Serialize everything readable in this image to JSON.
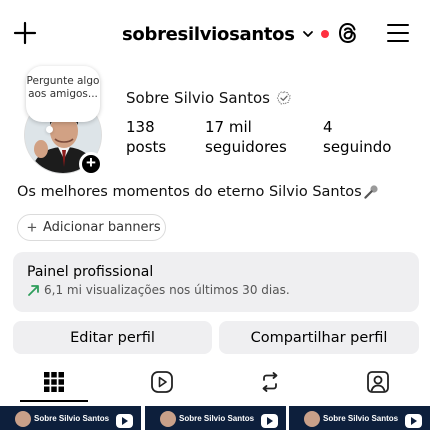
{
  "header": {
    "username": "sobresilviosantos",
    "icons": [
      "plus-icon",
      "chevron-down-icon",
      "threads-icon",
      "menu-icon"
    ],
    "notification_color": "#ff3040"
  },
  "profile": {
    "note": "Pergunte algo aos amigos...",
    "name": "Sobre Silvio Santos",
    "stats": [
      {
        "value": "138",
        "label": "posts"
      },
      {
        "value": "17 mil",
        "label": "seguidores"
      },
      {
        "value": "4",
        "label": "seguindo"
      }
    ],
    "bio": "Os melhores momentos do eterno Silvio Santos",
    "add_banners": "Adicionar banners"
  },
  "dashboard": {
    "title": "Painel profissional",
    "subtitle": "6,1 mi visualizações nos últimos 30 dias.",
    "accent_color": "#2e9d5b"
  },
  "actions": {
    "edit": "Editar perfil",
    "share": "Compartilhar perfil"
  },
  "tabs": [
    "grid-icon",
    "reels-icon",
    "reposts-icon",
    "tagged-icon"
  ],
  "thumbnails": [
    {
      "caption": "Sobre Silvio Santos"
    },
    {
      "caption": "Sobre Silvio Santos"
    },
    {
      "caption": "Sobre Silvio Santos"
    }
  ]
}
